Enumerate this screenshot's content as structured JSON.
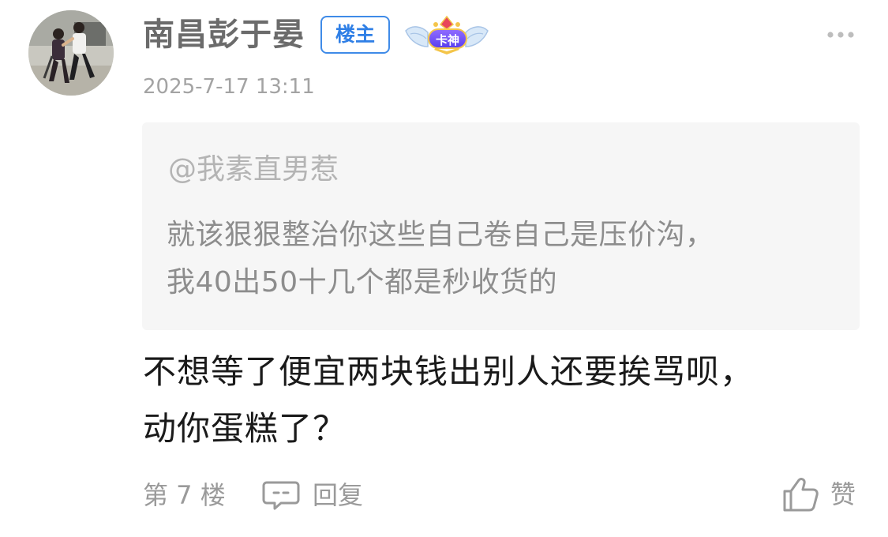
{
  "post": {
    "author": {
      "name": "南昌彭于晏",
      "op_badge": "楼主",
      "card_badge": "卡神"
    },
    "timestamp": "2025-7-17 13:11",
    "quote": {
      "author": "@我素直男惹",
      "lines": [
        "就该狠狠整治你这些自己卷自己是压价沟，",
        "我40出50十几个都是秒收货的"
      ]
    },
    "comment": {
      "lines": [
        "不想等了便宜两块钱出别人还要挨骂呗，",
        "动你蛋糕了？"
      ]
    },
    "footer": {
      "floor": "第 7 楼",
      "reply_label": "回复",
      "like_label": "赞"
    }
  },
  "colors": {
    "op_badge_blue": "#2f7fe6",
    "card_badge_purple": "#6a4cf5",
    "card_badge_gold": "#f4c54a",
    "quote_background": "#f6f6f6",
    "secondary_text": "#9a9a9a"
  },
  "icons": {
    "more": "more-dots-icon",
    "reply": "comment-bubble-icon",
    "like": "thumbs-up-icon"
  }
}
